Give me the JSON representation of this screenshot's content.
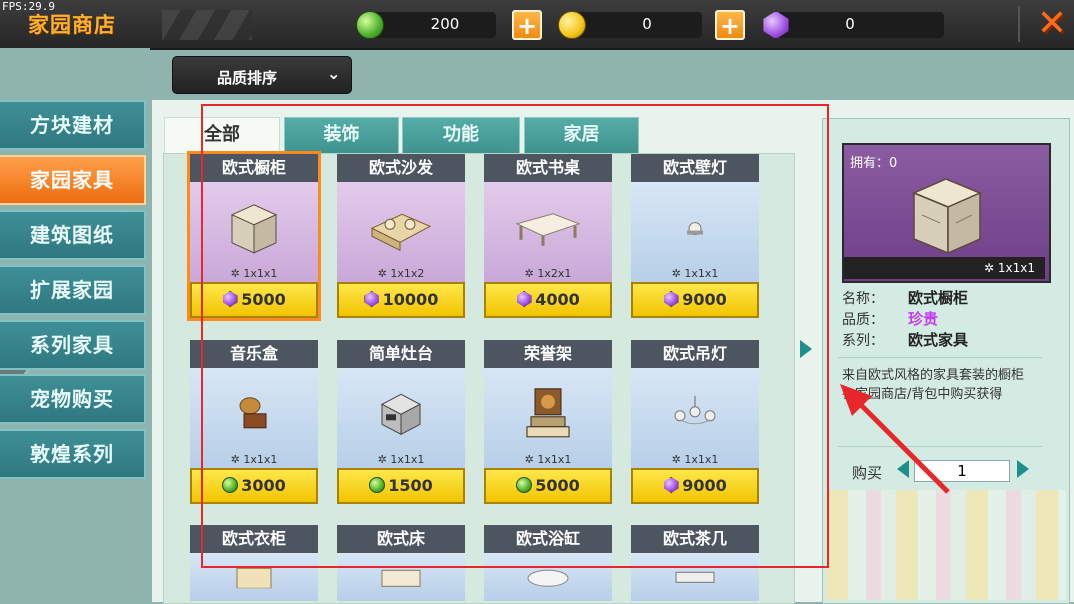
{
  "fps": "FPS:29.9",
  "shop_title": "家园商店",
  "currencies": [
    {
      "icon": "green-gem-icon",
      "value": "200"
    },
    {
      "icon": "gold-coin-icon",
      "value": "0"
    },
    {
      "icon": "purple-gem-icon",
      "value": "0"
    }
  ],
  "plus_label": "+",
  "close_label": "✕",
  "sort": {
    "label": "品质排序",
    "chevron": "⌄"
  },
  "nav": [
    "方块建材",
    "家园家具",
    "建筑图纸",
    "扩展家园",
    "系列家具",
    "宠物购买",
    "敦煌系列"
  ],
  "nav_active_index": 1,
  "tabs": [
    "全部",
    "装饰",
    "功能",
    "家居"
  ],
  "tab_active_index": 0,
  "items": [
    {
      "name": "欧式橱柜",
      "size": "1x1x1",
      "price": "5000",
      "currency": "purple",
      "bg": "purple",
      "icon": "cabinet-icon"
    },
    {
      "name": "欧式沙发",
      "size": "1x1x2",
      "price": "10000",
      "currency": "purple",
      "bg": "purple",
      "icon": "sofa-icon"
    },
    {
      "name": "欧式书桌",
      "size": "1x2x1",
      "price": "4000",
      "currency": "purple",
      "bg": "purple",
      "icon": "desk-icon"
    },
    {
      "name": "欧式壁灯",
      "size": "1x1x1",
      "price": "9000",
      "currency": "purple",
      "bg": "blue",
      "icon": "wall-lamp-icon"
    },
    {
      "name": "音乐盒",
      "size": "1x1x1",
      "price": "3000",
      "currency": "green",
      "bg": "blue",
      "icon": "music-box-icon"
    },
    {
      "name": "简单灶台",
      "size": "1x1x1",
      "price": "1500",
      "currency": "green",
      "bg": "blue",
      "icon": "stove-icon"
    },
    {
      "name": "荣誉架",
      "size": "1x1x1",
      "price": "5000",
      "currency": "green",
      "bg": "blue",
      "icon": "honor-shelf-icon"
    },
    {
      "name": "欧式吊灯",
      "size": "1x1x1",
      "price": "9000",
      "currency": "purple",
      "bg": "blue",
      "icon": "chandelier-icon"
    },
    {
      "name": "欧式衣柜",
      "size": "",
      "price": "",
      "currency": "",
      "bg": "blue",
      "icon": "wardrobe-icon"
    },
    {
      "name": "欧式床",
      "size": "",
      "price": "",
      "currency": "",
      "bg": "blue",
      "icon": "bed-icon"
    },
    {
      "name": "欧式浴缸",
      "size": "",
      "price": "",
      "currency": "",
      "bg": "blue",
      "icon": "bathtub-icon"
    },
    {
      "name": "欧式茶几",
      "size": "",
      "price": "",
      "currency": "",
      "bg": "blue",
      "icon": "tea-table-icon"
    }
  ],
  "selected_index": 0,
  "detail": {
    "owned": "拥有：0",
    "size": "1x1x1",
    "name_label": "名称：",
    "name_value": "欧式橱柜",
    "quality_label": "品质：",
    "quality_value": "珍贵",
    "quality_color": "#c43cf0",
    "series_label": "系列：",
    "series_value": "欧式家具",
    "description": "来自欧式风格的家具套装的橱柜",
    "source": "在家园商店/背包中购买获得",
    "buy_label": "购买",
    "quantity": "1"
  },
  "colors": {
    "accent_orange": "#ee6d10",
    "teal": "#2f7880",
    "annotation_red": "#e8272a"
  }
}
